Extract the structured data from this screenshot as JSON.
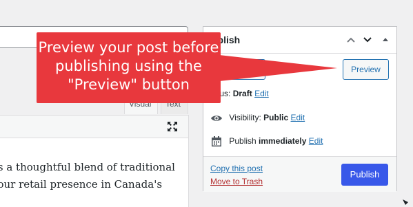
{
  "editor": {
    "tabs": [
      {
        "label": "Visual"
      },
      {
        "label": "Text"
      }
    ],
    "content_lines": [
      "es a thoughtful blend of traditional",
      "your retail presence in Canada's"
    ]
  },
  "publish_box": {
    "title": "ublish",
    "preview_label": "Preview",
    "status": {
      "label": "tatus:",
      "value": "Draft",
      "edit": "Edit"
    },
    "visibility": {
      "label": "Visibility:",
      "value": "Public",
      "edit": "Edit"
    },
    "schedule": {
      "label": "Publish",
      "value": "immediately",
      "edit": "Edit"
    },
    "copy_link": "Copy this post",
    "trash_link": "Move to Trash",
    "publish_label": "Publish"
  },
  "callout": {
    "text": "Preview your post before publishing using the \"Preview\" button",
    "color": "#e8383d"
  },
  "colors": {
    "accent": "#2271b1",
    "primary_button": "#3858e9",
    "danger": "#b32d2e"
  }
}
